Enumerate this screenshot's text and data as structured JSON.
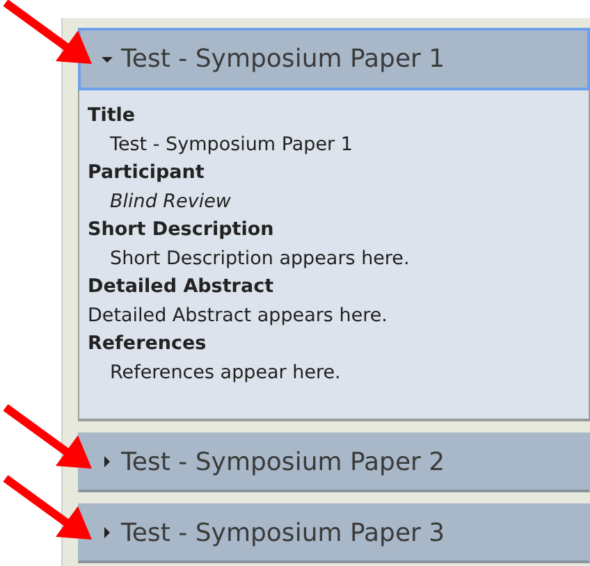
{
  "sections": [
    {
      "title": "Test - Symposium Paper 1",
      "expanded": true,
      "focused": true,
      "arrow": true,
      "fields": [
        {
          "label": "Title",
          "value": "Test - Symposium Paper 1",
          "indented": true,
          "italic": false
        },
        {
          "label": "Participant",
          "value": "Blind Review",
          "indented": true,
          "italic": true
        },
        {
          "label": "Short Description",
          "value": "Short Description appears here.",
          "indented": true,
          "italic": false
        },
        {
          "label": "Detailed Abstract",
          "value": "Detailed Abstract appears here.",
          "indented": false,
          "italic": false
        },
        {
          "label": "References",
          "value": "References appear here.",
          "indented": true,
          "italic": false
        }
      ]
    },
    {
      "title": "Test - Symposium Paper 2",
      "expanded": false,
      "focused": false,
      "arrow": true
    },
    {
      "title": "Test - Symposium Paper 3",
      "expanded": false,
      "focused": false,
      "arrow": true
    }
  ]
}
